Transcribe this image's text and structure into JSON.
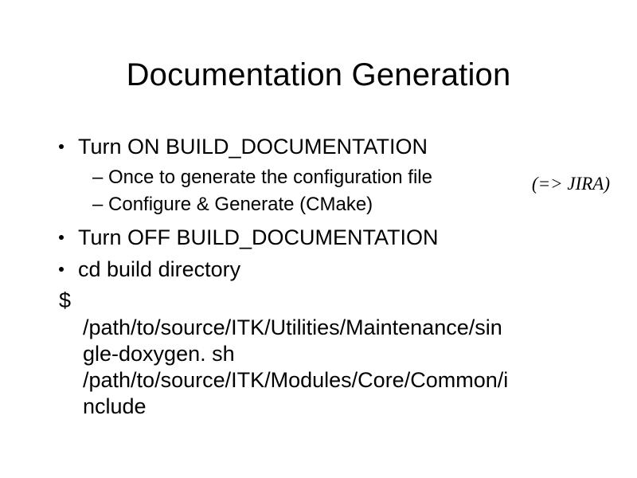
{
  "title": "Documentation Generation",
  "bullets": {
    "b1": "Turn ON BUILD_DOCUMENTATION",
    "b1_sub1": "– Once to generate the configuration file",
    "b1_sub2": "– Configure & Generate (CMake)",
    "b2": "Turn OFF BUILD_DOCUMENTATION",
    "b3": "cd build directory"
  },
  "dollar": "$",
  "cmd_line1": "/path/to/source/ITK/Utilities/Maintenance/sin",
  "cmd_line2": "gle-doxygen. sh",
  "cmd_line3": "/path/to/source/ITK/Modules/Core/Common/i",
  "cmd_line4": "nclude",
  "jira_note": "(=> JIRA)"
}
